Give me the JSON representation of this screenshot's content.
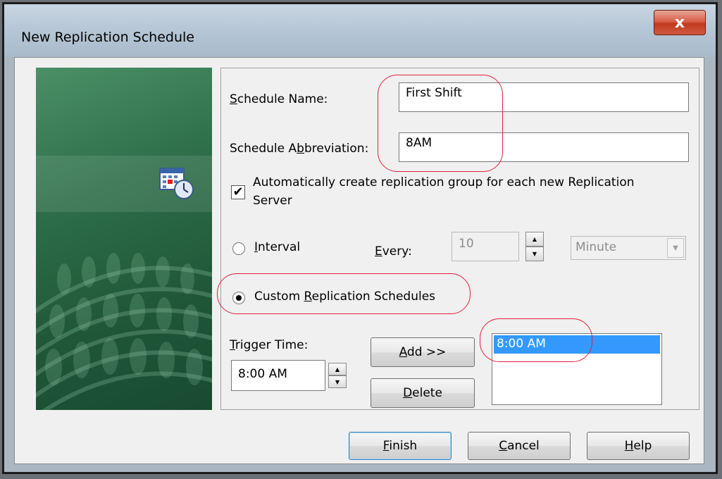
{
  "window": {
    "title": "New Replication Schedule",
    "close_glyph": "x"
  },
  "form": {
    "schedule_name_label": "Schedule Name:",
    "schedule_name_value": "First Shift",
    "abbreviation_label": "Schedule Abbreviation:",
    "abbreviation_value": "8AM",
    "auto_create_label_line1": "Automatically create replication group for each new Replication",
    "auto_create_label_line2": "Server",
    "auto_create_checked": true,
    "interval_label": "Interval",
    "interval_selected": false,
    "every_label": "Every:",
    "every_value": "10",
    "every_unit": "Minute",
    "custom_label": "Custom Replication Schedules",
    "custom_selected": true,
    "trigger_time_label": "Trigger Time:",
    "trigger_time_value": "8:00 AM",
    "add_button": "Add >>",
    "delete_button": "Delete",
    "schedule_times": [
      "8:00 AM"
    ]
  },
  "footer": {
    "finish_button": "Finish",
    "cancel_button": "Cancel",
    "help_button": "Help"
  },
  "icons": {
    "schedule": "calendar-clock-icon",
    "close": "close-icon"
  },
  "colors": {
    "annotation": "#e0203c",
    "selection": "#3399ff",
    "banner": "#2e6f4a"
  }
}
